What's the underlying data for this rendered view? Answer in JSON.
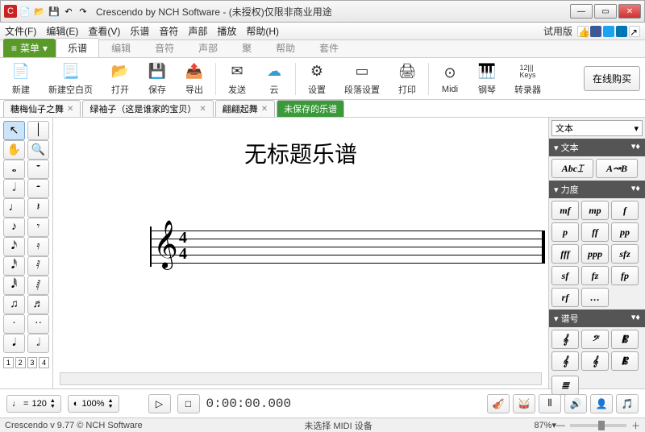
{
  "window": {
    "title": "Crescendo by NCH Software - (未授权)仅限非商业用途"
  },
  "menus": {
    "file": "文件(F)",
    "edit": "编辑(E)",
    "view": "查看(V)",
    "score": "乐谱",
    "notes": "音符",
    "parts": "声部",
    "play": "播放",
    "help": "帮助(H)",
    "trial": "试用版"
  },
  "ribbon_tabs": {
    "menu": "菜单",
    "score": "乐谱",
    "edit": "编辑",
    "notes": "音符",
    "parts": "声部",
    "group": "聚",
    "play": "帮助",
    "kit": "套件"
  },
  "ribbon": {
    "new": "新建",
    "newblank": "新建空白页",
    "open": "打开",
    "save": "保存",
    "export": "导出",
    "send": "发送",
    "cloud": "云",
    "settings": "设置",
    "section": "段落设置",
    "print": "打印",
    "midi": "Midi",
    "piano": "钢琴",
    "converter": "转录器",
    "buy": "在线购买",
    "keys_label": "12|||\nKeys"
  },
  "doctabs": [
    {
      "label": "糖梅仙子之舞",
      "active": false,
      "closable": true
    },
    {
      "label": "绿袖子（这是谁家的宝贝）",
      "active": false,
      "closable": true
    },
    {
      "label": "翩翩起舞",
      "active": false,
      "closable": true
    },
    {
      "label": "未保存的乐谱",
      "active": true,
      "closable": false
    }
  ],
  "canvas": {
    "title": "无标题乐谱",
    "clef": "𝄞",
    "timesig": "4/4"
  },
  "left_tools": {
    "rows": [
      [
        "↖",
        "│"
      ],
      [
        "✋",
        "🔍"
      ],
      [
        "𝅝",
        "𝄻"
      ],
      [
        "𝅗𝅥",
        "𝄼"
      ],
      [
        "♩",
        "𝄽"
      ],
      [
        "♪",
        "𝄾"
      ],
      [
        "𝅘𝅥𝅯",
        "𝄿"
      ],
      [
        "𝅘𝅥𝅰",
        "𝅀"
      ],
      [
        "𝅘𝅥𝅱",
        "𝅁"
      ],
      [
        "♫",
        "♬"
      ],
      [
        "·",
        "··"
      ],
      [
        "𝅘𝅥",
        "𝅗𝅥"
      ]
    ],
    "pages": [
      "1",
      "2",
      "3",
      "4"
    ]
  },
  "right_panel": {
    "category": "文本",
    "sections": {
      "text": {
        "title": "文本",
        "items": [
          "Abc⌶",
          "A↝B"
        ]
      },
      "dynamics": {
        "title": "力度",
        "items": [
          "mf",
          "mp",
          "f",
          "p",
          "ff",
          "pp",
          "fff",
          "ppp",
          "sfz",
          "sf",
          "fz",
          "fp",
          "rf",
          "…"
        ]
      },
      "clefs": {
        "title": "谱号",
        "items": [
          "𝄞",
          "𝄢",
          "𝄡",
          "𝄞",
          "𝄞",
          "𝄡"
        ]
      }
    },
    "extra": "≣"
  },
  "playbar": {
    "tempo_note": "♩ =",
    "tempo": "120",
    "zoom": "100%",
    "time": "0:00:00.000",
    "icons": [
      "🎻",
      "🥁",
      "⦀",
      "🔊",
      "👤",
      "🎵"
    ]
  },
  "status": {
    "version": "Crescendo v 9.77 © NCH Software",
    "midi": "未选择 MIDI 设备",
    "zoom": "87%"
  },
  "colors": {
    "accent_green": "#5a9a2a",
    "tab_active_green": "#3a9a3a"
  }
}
